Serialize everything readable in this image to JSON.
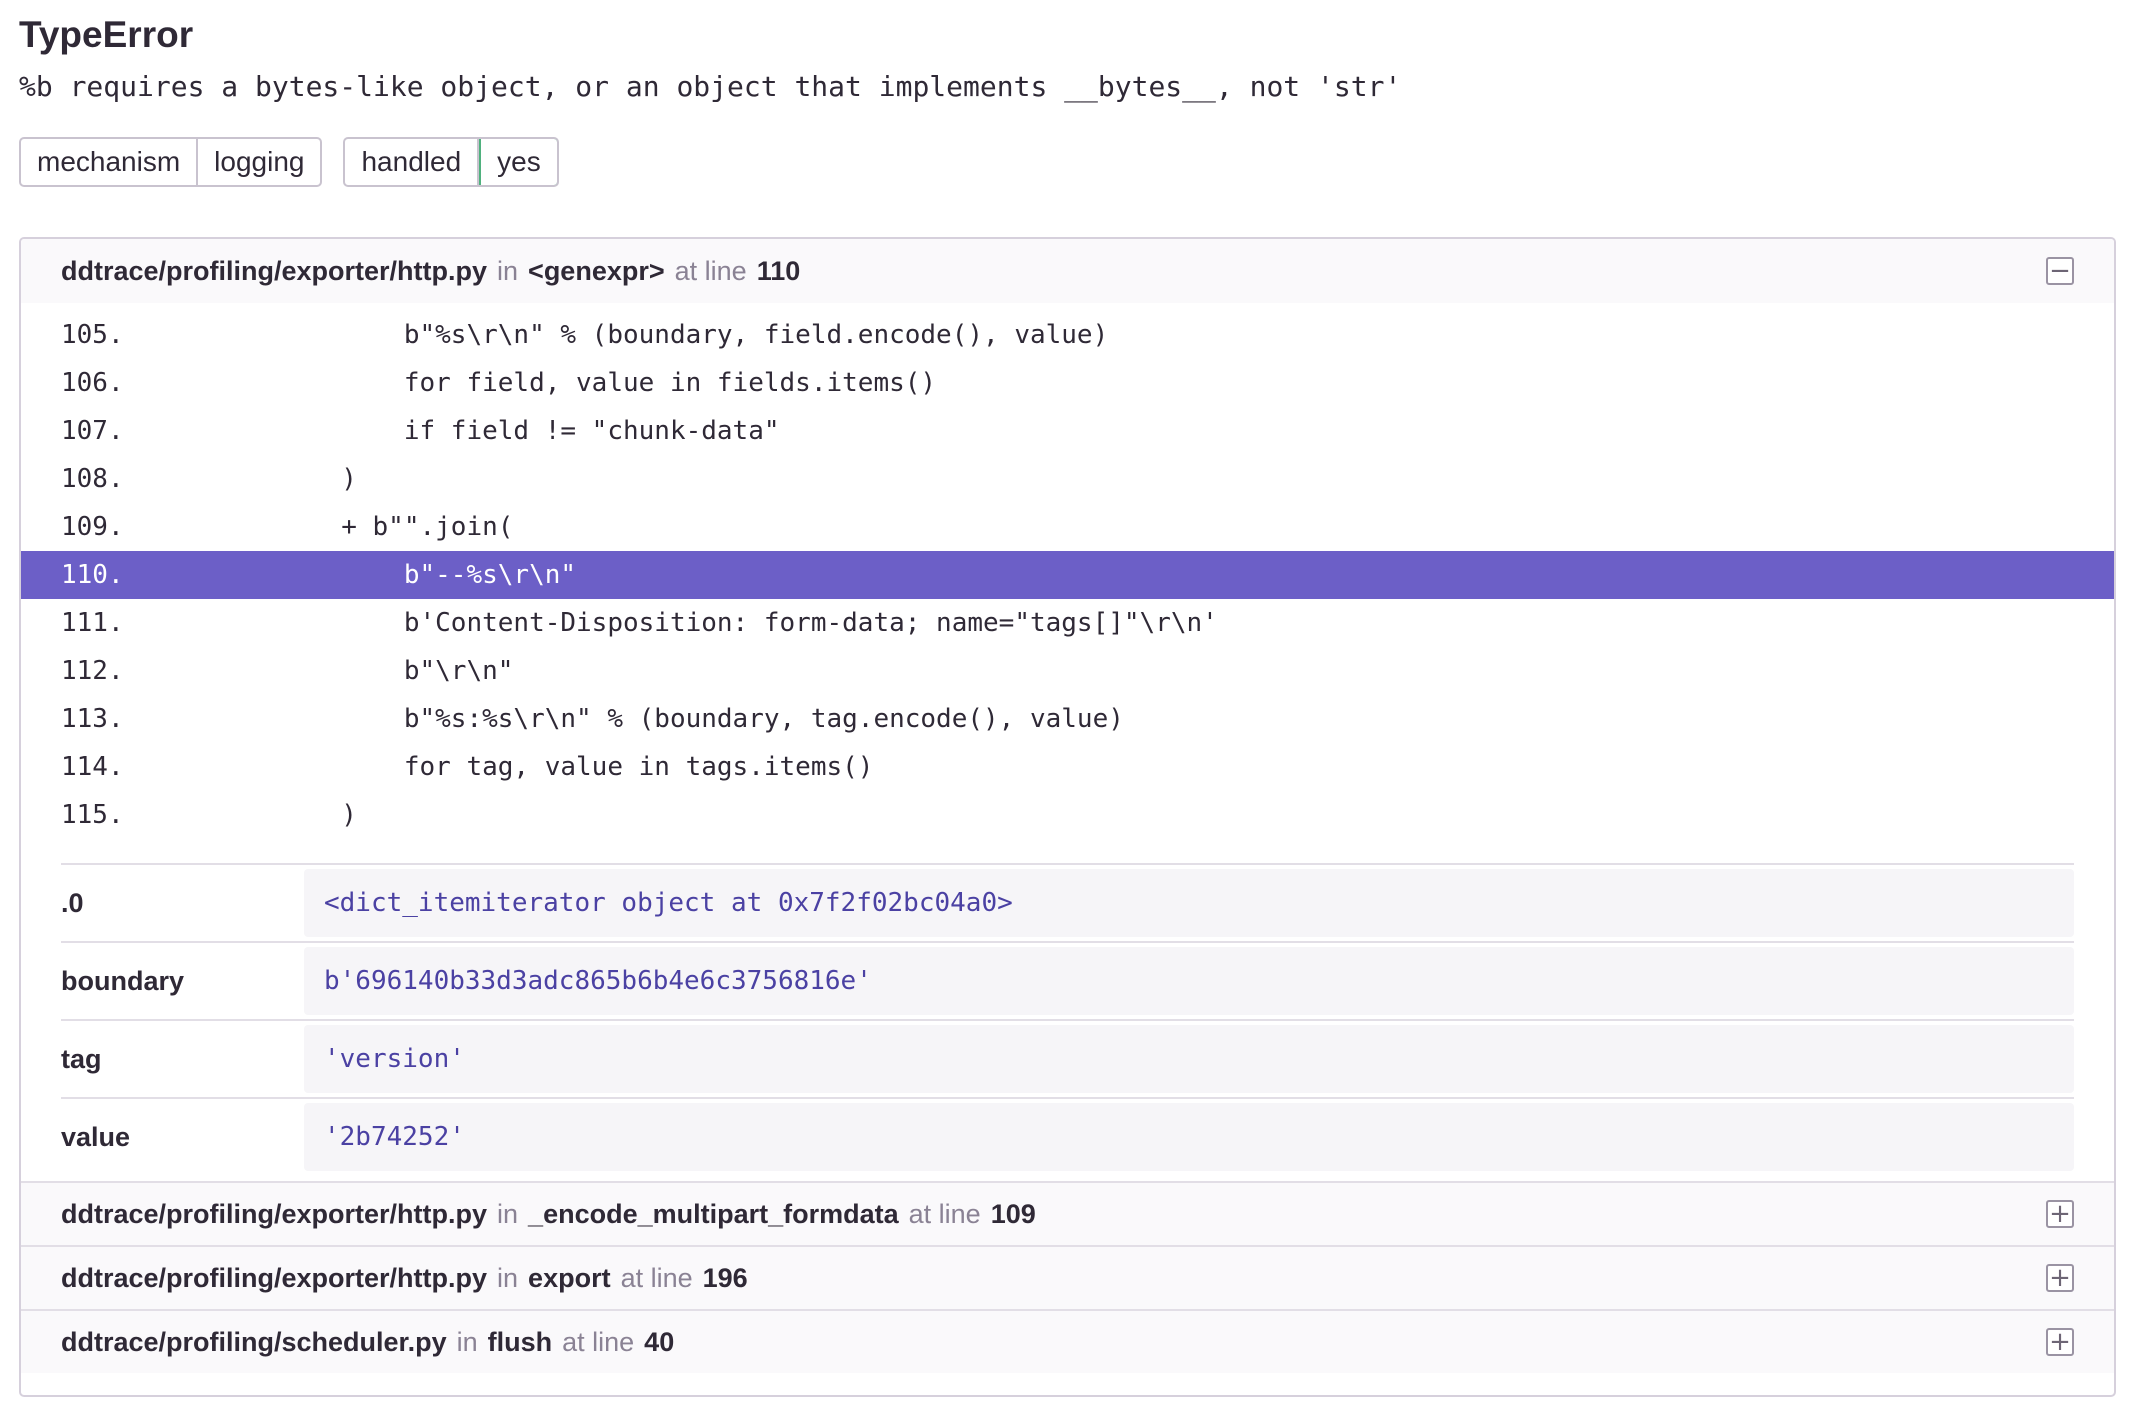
{
  "exception": {
    "type": "TypeError",
    "message": "%b requires a bytes-like object, or an object that implements __bytes__, not 'str'"
  },
  "tags": [
    {
      "key": "mechanism",
      "value": "logging"
    },
    {
      "key": "handled",
      "value": "yes"
    }
  ],
  "labels": {
    "in": "in",
    "at_line": "at line"
  },
  "frames": [
    {
      "file": "ddtrace/profiling/exporter/http.py",
      "function": "<genexpr>",
      "line": "110",
      "toggle": "−",
      "code": [
        {
          "num": "105.",
          "text": "            b\"%s\\r\\n\" % (boundary, field.encode(), value)"
        },
        {
          "num": "106.",
          "text": "            for field, value in fields.items()"
        },
        {
          "num": "107.",
          "text": "            if field != \"chunk-data\""
        },
        {
          "num": "108.",
          "text": "        )"
        },
        {
          "num": "109.",
          "text": "        + b\"\".join("
        },
        {
          "num": "110.",
          "text": "            b\"--%s\\r\\n\""
        },
        {
          "num": "111.",
          "text": "            b'Content-Disposition: form-data; name=\"tags[]\"\\r\\n'"
        },
        {
          "num": "112.",
          "text": "            b\"\\r\\n\""
        },
        {
          "num": "113.",
          "text": "            b\"%s:%s\\r\\n\" % (boundary, tag.encode(), value)"
        },
        {
          "num": "114.",
          "text": "            for tag, value in tags.items()"
        },
        {
          "num": "115.",
          "text": "        )"
        }
      ],
      "vars": [
        {
          "name": ".0",
          "value": "<dict_itemiterator object at 0x7f2f02bc04a0>"
        },
        {
          "name": "boundary",
          "value": "b'696140b33d3adc865b6b4e6c3756816e'"
        },
        {
          "name": "tag",
          "value": "'version'"
        },
        {
          "name": "value",
          "value": "'2b74252'"
        }
      ]
    },
    {
      "file": "ddtrace/profiling/exporter/http.py",
      "function": "_encode_multipart_formdata",
      "line": "109",
      "toggle": "+"
    },
    {
      "file": "ddtrace/profiling/exporter/http.py",
      "function": "export",
      "line": "196",
      "toggle": "+"
    },
    {
      "file": "ddtrace/profiling/scheduler.py",
      "function": "flush",
      "line": "40",
      "toggle": "+"
    }
  ]
}
